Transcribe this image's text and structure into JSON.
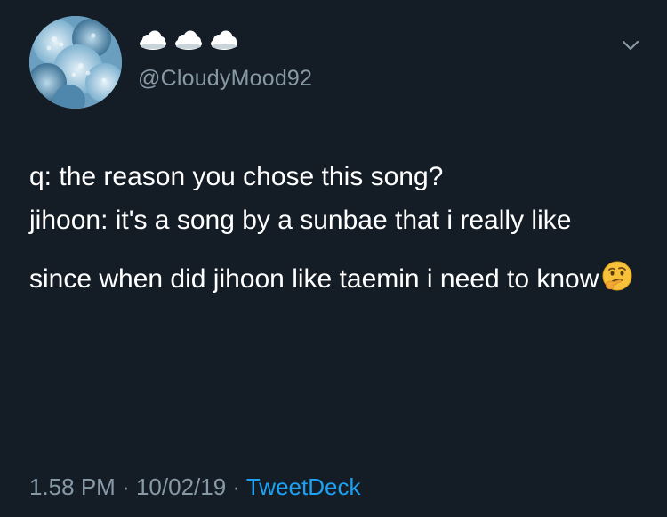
{
  "header": {
    "handle": "@CloudyMood92",
    "name_icons": [
      "cloud-icon",
      "cloud-icon",
      "cloud-icon"
    ],
    "menu_icon": "chevron-down-icon"
  },
  "tweet": {
    "paragraphs": [
      "q: the reason you chose this song?",
      "jihoon: it's a song by a sunbae that i really like",
      "since when did jihoon like taemin i need to know"
    ],
    "emoji": "thinking-face-icon"
  },
  "meta": {
    "time": "1.58 PM",
    "date": "10/02/19",
    "source": "TweetDeck",
    "separator": "·"
  },
  "colors": {
    "background": "#141d26",
    "text": "#ffffff",
    "secondary": "#8899a6",
    "link": "#1da1f2"
  }
}
